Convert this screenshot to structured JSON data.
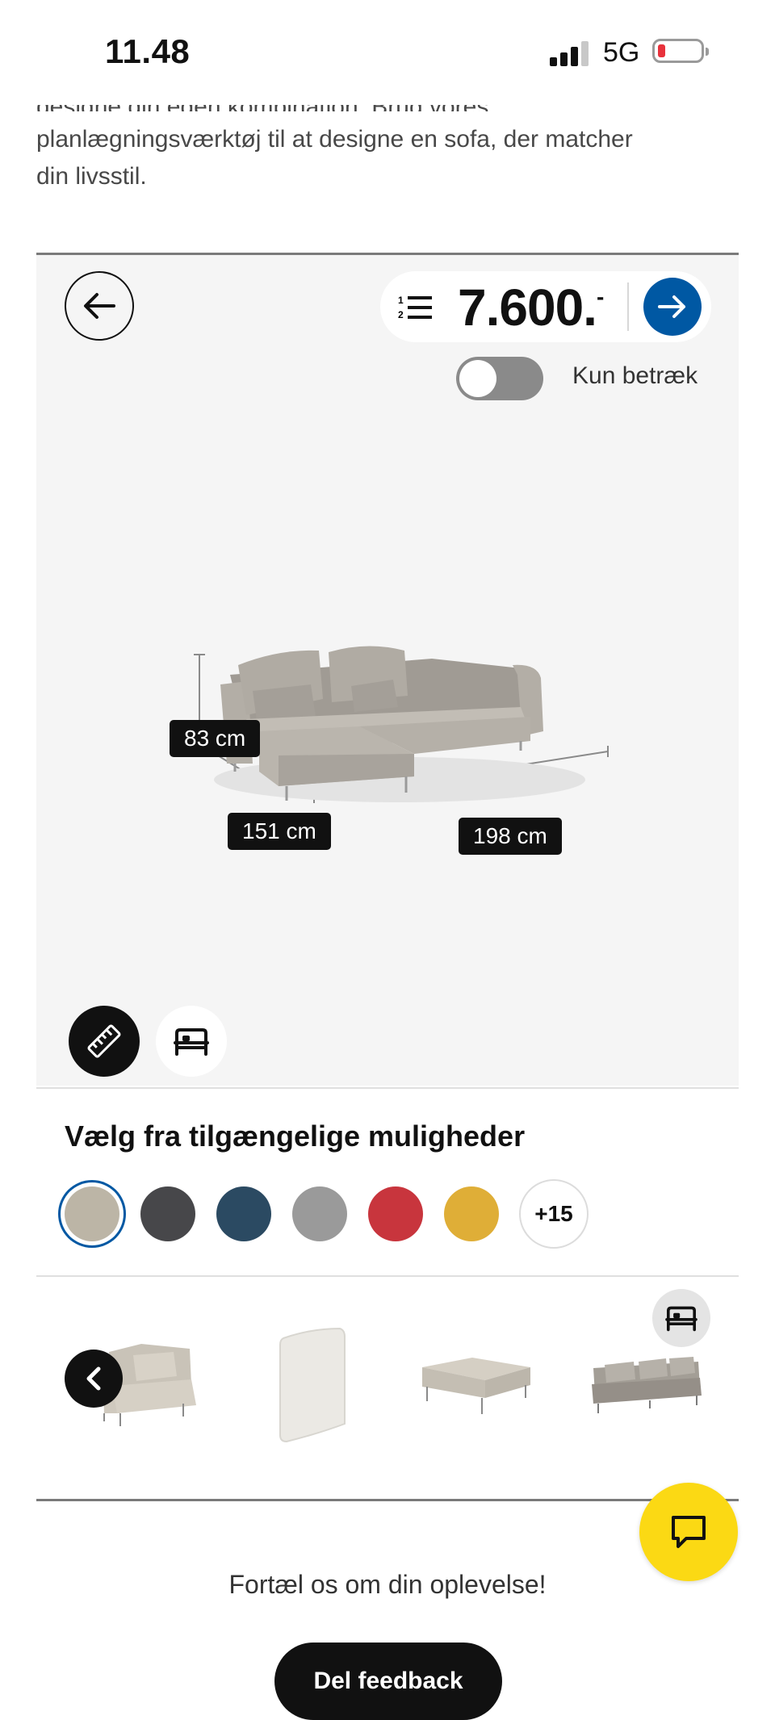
{
  "status_bar": {
    "time": "11.48",
    "network": "5G"
  },
  "intro": {
    "clipped_line": "designe din egen kombination. Brug vores",
    "lines": [
      "planlægningsværktøj til at designe en sofa, der matcher",
      "din livsstil."
    ]
  },
  "planner": {
    "price": "7.600.-",
    "price_display": "7.600.",
    "price_suffix": "-",
    "toggle_label": "Kun betræk",
    "toggle_on": false,
    "dimensions": {
      "height": "83 cm",
      "depth": "151 cm",
      "width": "198 cm"
    }
  },
  "options": {
    "title": "Vælg fra tilgængelige muligheder",
    "swatches": [
      {
        "name": "beige",
        "color": "#bcb5a6",
        "selected": true
      },
      {
        "name": "dark-grey",
        "color": "#47474a"
      },
      {
        "name": "blue",
        "color": "#2b4a62"
      },
      {
        "name": "grey",
        "color": "#9a9a9a"
      },
      {
        "name": "red",
        "color": "#c8353d"
      },
      {
        "name": "yellow",
        "color": "#dfae37"
      }
    ],
    "more_label": "+15"
  },
  "modules": [
    "corner-section",
    "back-cushion",
    "footstool",
    "3-seat-section"
  ],
  "feedback": {
    "text": "Fortæl os om din oplevelse!",
    "button": "Del feedback"
  },
  "colors": {
    "accent": "#0058a3",
    "chat": "#fbd914",
    "planner_bg": "#f5f5f5"
  }
}
